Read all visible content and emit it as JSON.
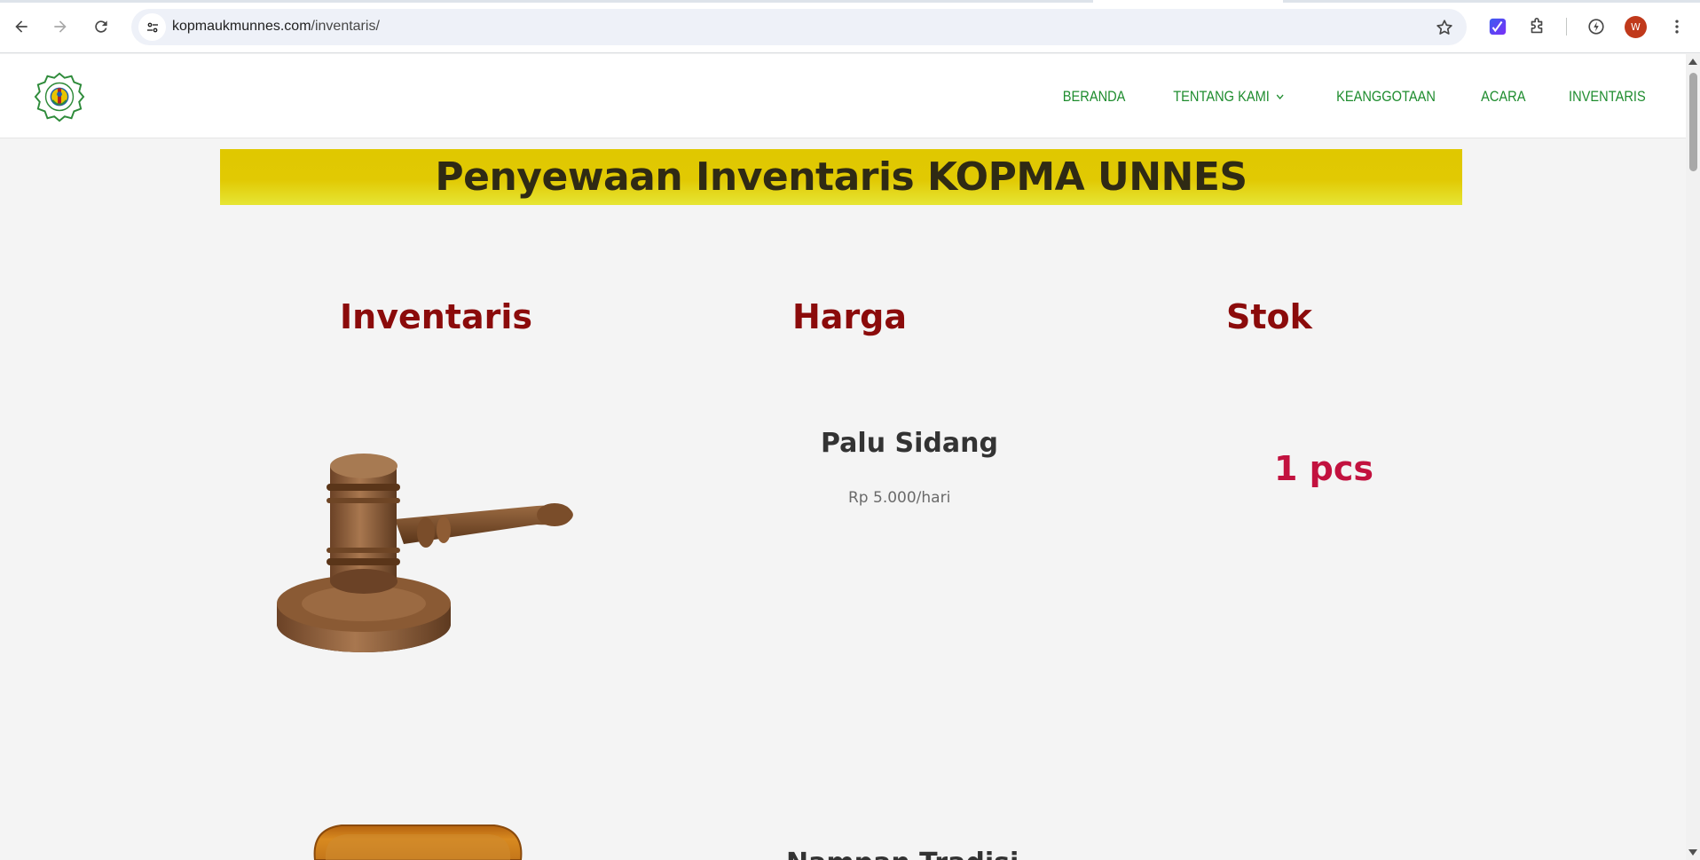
{
  "browser": {
    "url_host": "kopmaukmunnes.com",
    "url_path": "/inventaris/",
    "profile_initial": "W",
    "accent": "#c0391b"
  },
  "site": {
    "logo_icon": "kopma-logo-icon",
    "nav": [
      {
        "label": "BERANDA"
      },
      {
        "label": "TENTANG KAMI",
        "has_dropdown": true
      },
      {
        "label": "KEANGGOTAAN"
      },
      {
        "label": "ACARA"
      },
      {
        "label": "INVENTARIS"
      }
    ],
    "nav_color": "#1e8c2e"
  },
  "page": {
    "title": "Penyewaan Inventaris KOPMA UNNES",
    "banner_color": "#e0c800",
    "columns": {
      "inventaris": "Inventaris",
      "harga": "Harga",
      "stok": "Stok"
    },
    "items": [
      {
        "name": "Palu Sidang",
        "price": "Rp 5.000/hari",
        "stock": "1 pcs",
        "image_icon": "gavel-image"
      },
      {
        "name": "Nampan Tradisi...",
        "image_icon": "wooden-tray-image"
      }
    ]
  }
}
